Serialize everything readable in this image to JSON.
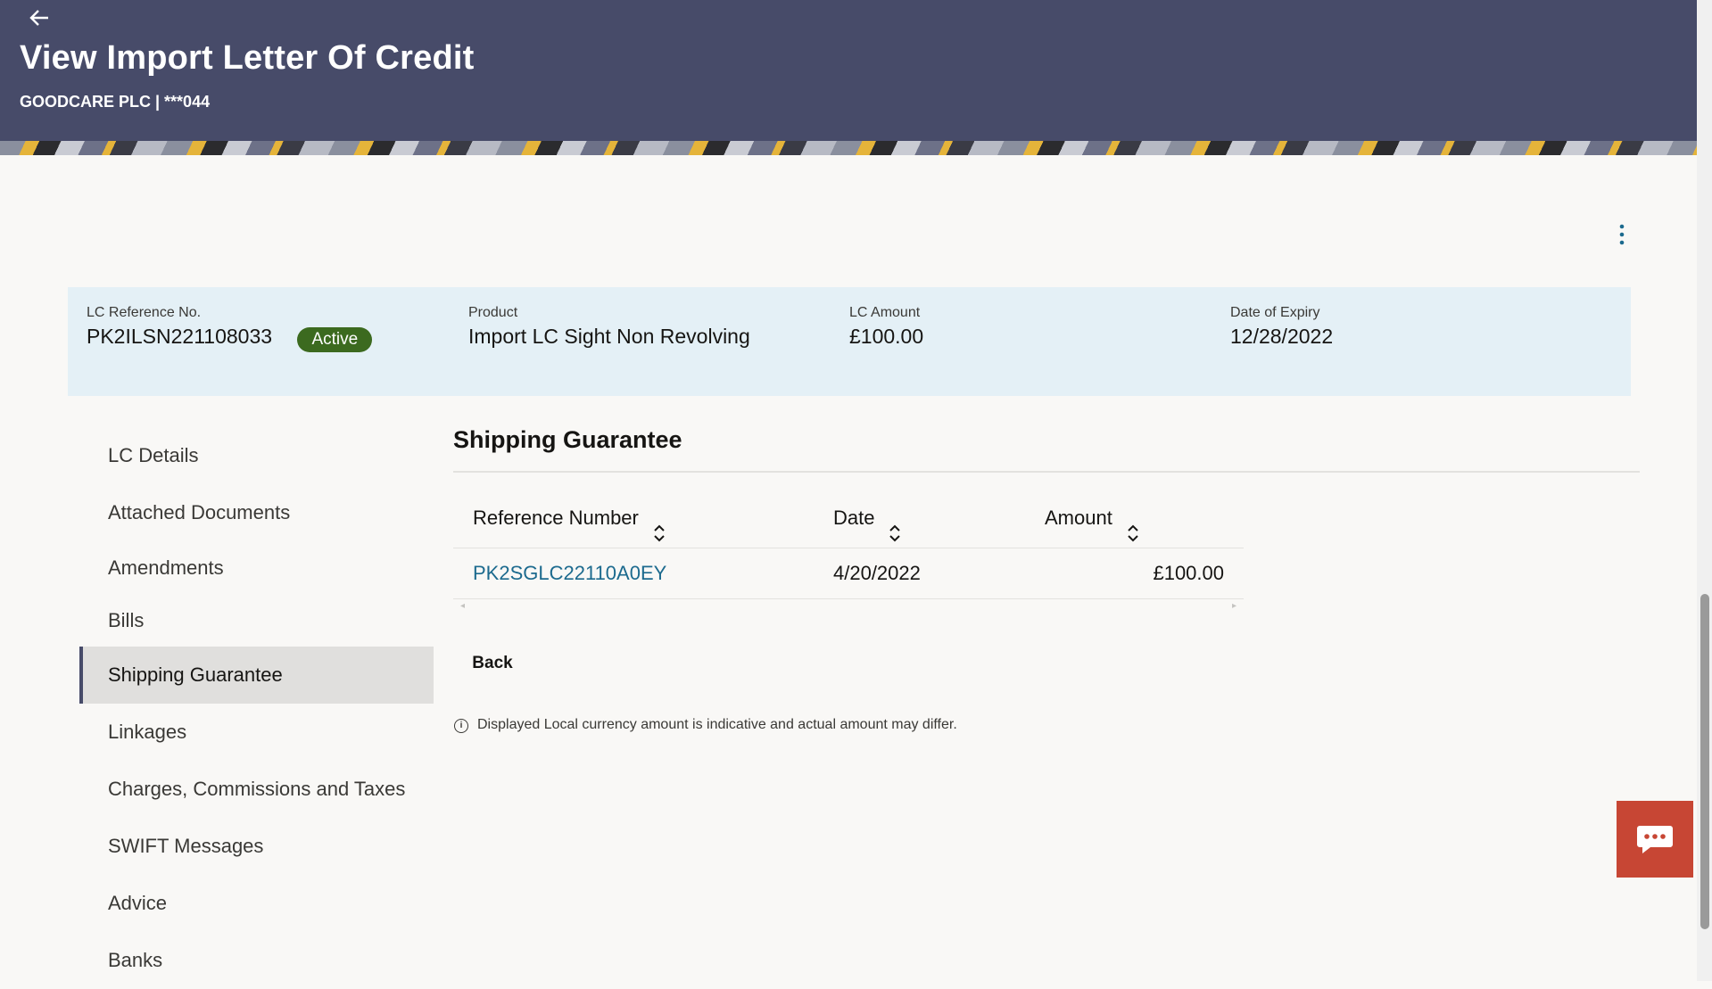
{
  "header": {
    "back_icon": "arrow-left-icon",
    "title": "View Import Letter Of Credit",
    "subtitle": "GOODCARE PLC | ***044"
  },
  "summary": {
    "lc_ref_label": "LC Reference No.",
    "lc_ref_value": "PK2ILSN221108033",
    "status": "Active",
    "product_label": "Product",
    "product_value": "Import LC Sight Non Revolving",
    "amount_label": "LC Amount",
    "amount_value": "£100.00",
    "expiry_label": "Date of Expiry",
    "expiry_value": "12/28/2022"
  },
  "sidenav": {
    "items": [
      {
        "label": "LC Details"
      },
      {
        "label": "Attached Documents"
      },
      {
        "label": "Amendments"
      },
      {
        "label": "Bills"
      },
      {
        "label": "Shipping Guarantee",
        "active": true
      },
      {
        "label": "Linkages"
      },
      {
        "label": "Charges, Commissions and Taxes"
      },
      {
        "label": "SWIFT Messages"
      },
      {
        "label": "Advice"
      },
      {
        "label": "Banks"
      }
    ]
  },
  "main": {
    "section_title": "Shipping Guarantee",
    "columns": [
      "Reference Number",
      "Date",
      "Amount"
    ],
    "rows": [
      {
        "reference": "PK2SGLC22110A0EY",
        "date": "4/20/2022",
        "amount": "£100.00"
      }
    ],
    "back_label": "Back",
    "note": "Displayed Local currency amount is indicative and actual amount may differ."
  },
  "colors": {
    "header_bg": "#474b69",
    "accent": "#1c6a8e",
    "badge_bg": "#3c6a1f",
    "chat_bg": "#c74634"
  }
}
